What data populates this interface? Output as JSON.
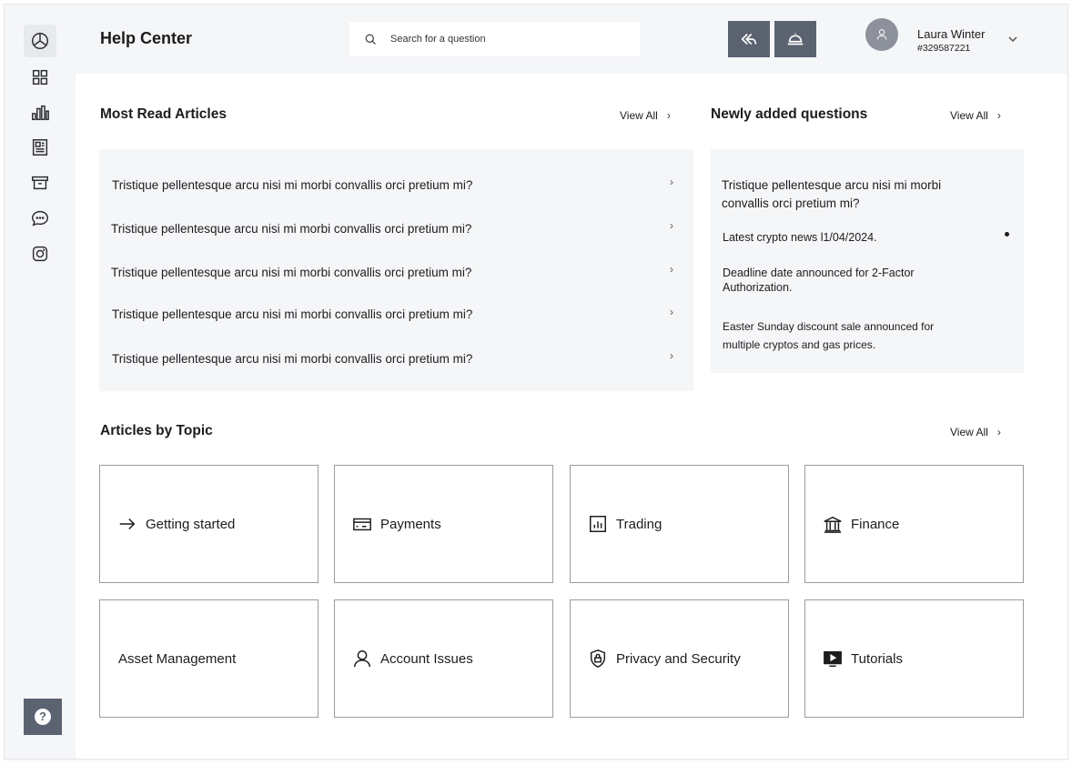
{
  "header": {
    "title": "Help Center",
    "search_placeholder": "Search for a question",
    "user": {
      "name": "Laura Winter",
      "id": "#329587221"
    }
  },
  "sidebar": {
    "items": [
      {
        "icon": "pie-chart-icon",
        "active": true
      },
      {
        "icon": "grid-icon",
        "active": false
      },
      {
        "icon": "bar-chart-icon",
        "active": false
      },
      {
        "icon": "newspaper-icon",
        "active": false
      },
      {
        "icon": "archive-icon",
        "active": false
      },
      {
        "icon": "chat-bubble-icon",
        "active": false
      },
      {
        "icon": "instagram-icon",
        "active": false
      }
    ],
    "help_glyph": "?"
  },
  "most_read": {
    "title": "Most Read Articles",
    "view_all": "View All",
    "items": [
      "Tristique pellentesque arcu nisi mi morbi convallis orci pretium mi?",
      "Tristique pellentesque arcu nisi mi morbi convallis orci pretium mi?",
      "Tristique pellentesque arcu nisi mi morbi convallis orci pretium mi?",
      "Tristique pellentesque arcu nisi mi morbi convallis orci pretium mi?",
      "Tristique pellentesque arcu nisi mi morbi convallis orci pretium mi?"
    ]
  },
  "newly_added": {
    "title": "Newly added questions",
    "view_all": "View All",
    "items": [
      "Tristique pellentesque arcu nisi mi morbi convallis orci pretium mi?",
      "Latest crypto news l1/04/2024.",
      "Deadline date announced for 2-Factor Authorization.",
      "Easter Sunday discount sale announced for multiple cryptos and gas prices."
    ]
  },
  "topics": {
    "title": "Articles by Topic",
    "view_all": "View All",
    "cards": [
      {
        "label": "Getting started",
        "icon": "arrow-right-icon"
      },
      {
        "label": "Payments",
        "icon": "credit-card-icon"
      },
      {
        "label": "Trading",
        "icon": "chart-icon"
      },
      {
        "label": "Finance",
        "icon": "bank-icon"
      },
      {
        "label": "Asset Management",
        "icon": ""
      },
      {
        "label": "Account Issues",
        "icon": "user-icon"
      },
      {
        "label": "Privacy and Security",
        "icon": "shield-lock-icon"
      },
      {
        "label": "Tutorials",
        "icon": "video-icon"
      }
    ]
  },
  "colors": {
    "panel_bg": "#f5f6f8",
    "button_bg": "#5b6270",
    "avatar_bg": "#8d919b",
    "text": "#1c1c1e"
  }
}
